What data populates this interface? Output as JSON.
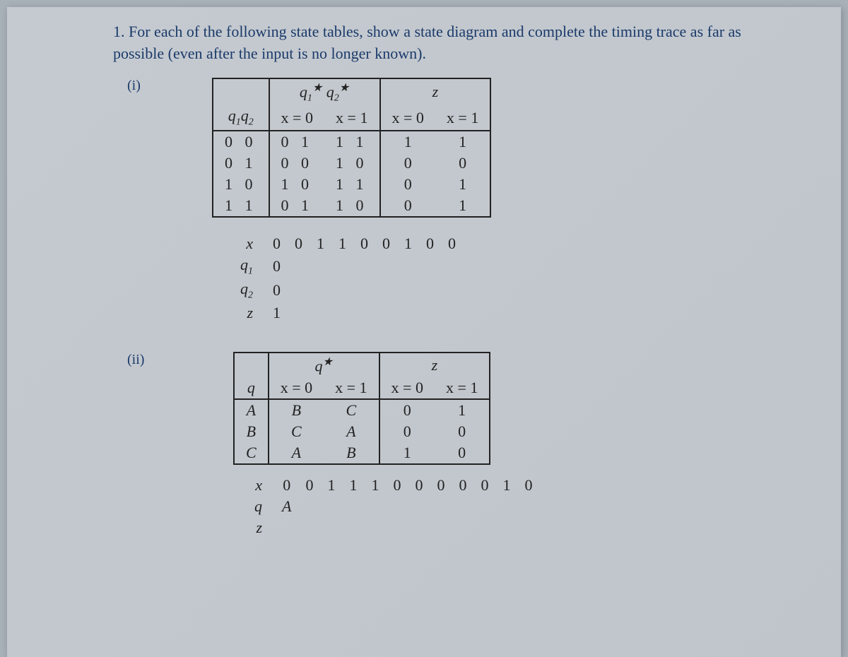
{
  "problem": {
    "number": "1.",
    "text": "For each of the following state tables, show a state diagram and complete the timing trace as far as possible (even after the input is no longer known)."
  },
  "part_i": {
    "label": "(i)",
    "table": {
      "col_state_hdr": "q₁q₂",
      "next_state_hdr": "q₁★ q₂★",
      "output_hdr": "z",
      "x0": "x = 0",
      "x1": "x = 1",
      "rows": [
        {
          "state": "0 0",
          "ns0": "0 1",
          "ns1": "1 1",
          "z0": "1",
          "z1": "1"
        },
        {
          "state": "0 1",
          "ns0": "0 0",
          "ns1": "1 0",
          "z0": "0",
          "z1": "0"
        },
        {
          "state": "1 0",
          "ns0": "1 0",
          "ns1": "1 1",
          "z0": "0",
          "z1": "1"
        },
        {
          "state": "1 1",
          "ns0": "0 1",
          "ns1": "1 0",
          "z0": "0",
          "z1": "1"
        }
      ]
    },
    "trace": {
      "x_label": "x",
      "x_vals": [
        "0",
        "0",
        "1",
        "1",
        "0",
        "0",
        "1",
        "0",
        "0"
      ],
      "q1_label": "q₁",
      "q1_init": "0",
      "q2_label": "q₂",
      "q2_init": "0",
      "z_label": "z",
      "z_init": "1"
    }
  },
  "part_ii": {
    "label": "(ii)",
    "table": {
      "col_state_hdr": "q",
      "next_state_hdr": "q★",
      "output_hdr": "z",
      "x0": "x = 0",
      "x1": "x = 1",
      "rows": [
        {
          "state": "A",
          "ns0": "B",
          "ns1": "C",
          "z0": "0",
          "z1": "1"
        },
        {
          "state": "B",
          "ns0": "C",
          "ns1": "A",
          "z0": "0",
          "z1": "0"
        },
        {
          "state": "C",
          "ns0": "A",
          "ns1": "B",
          "z0": "1",
          "z1": "0"
        }
      ]
    },
    "trace": {
      "x_label": "x",
      "x_vals": [
        "0",
        "0",
        "1",
        "1",
        "1",
        "0",
        "0",
        "0",
        "0",
        "0",
        "1",
        "0"
      ],
      "q_label": "q",
      "q_init": "A",
      "z_label": "z"
    }
  }
}
